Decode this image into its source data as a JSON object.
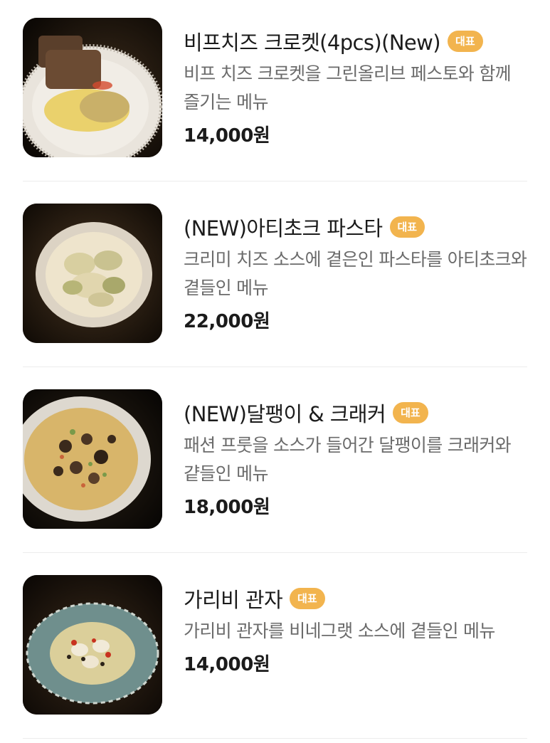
{
  "badge_label": "대표",
  "badge_color": "#f2b44e",
  "items": [
    {
      "name": "비프치즈 크로켓(4pcs)(New)",
      "description": "비프 치즈 크로켓을 그린올리브 페스토와 함께 즐기는 메뉴",
      "price": "14,000원",
      "photo": "beef-cheese-croquette-photo"
    },
    {
      "name": "(NEW)아티초크 파스타",
      "description": "크리미 치즈 소스에 곁은인 파스타를 아티초크와 곁들인 메뉴",
      "price": "22,000원",
      "photo": "artichoke-pasta-photo"
    },
    {
      "name": "(NEW)달팽이 & 크래커",
      "description": "패션 프룻을 소스가 들어간 달팽이를 크래커와 걑들인 메뉴",
      "price": "18,000원",
      "photo": "snail-cracker-photo"
    },
    {
      "name": "가리비 관자",
      "description": "가리비 관자를 비네그랫 소스에 곁들인 메뉴",
      "price": "14,000원",
      "photo": "scallop-photo"
    }
  ]
}
